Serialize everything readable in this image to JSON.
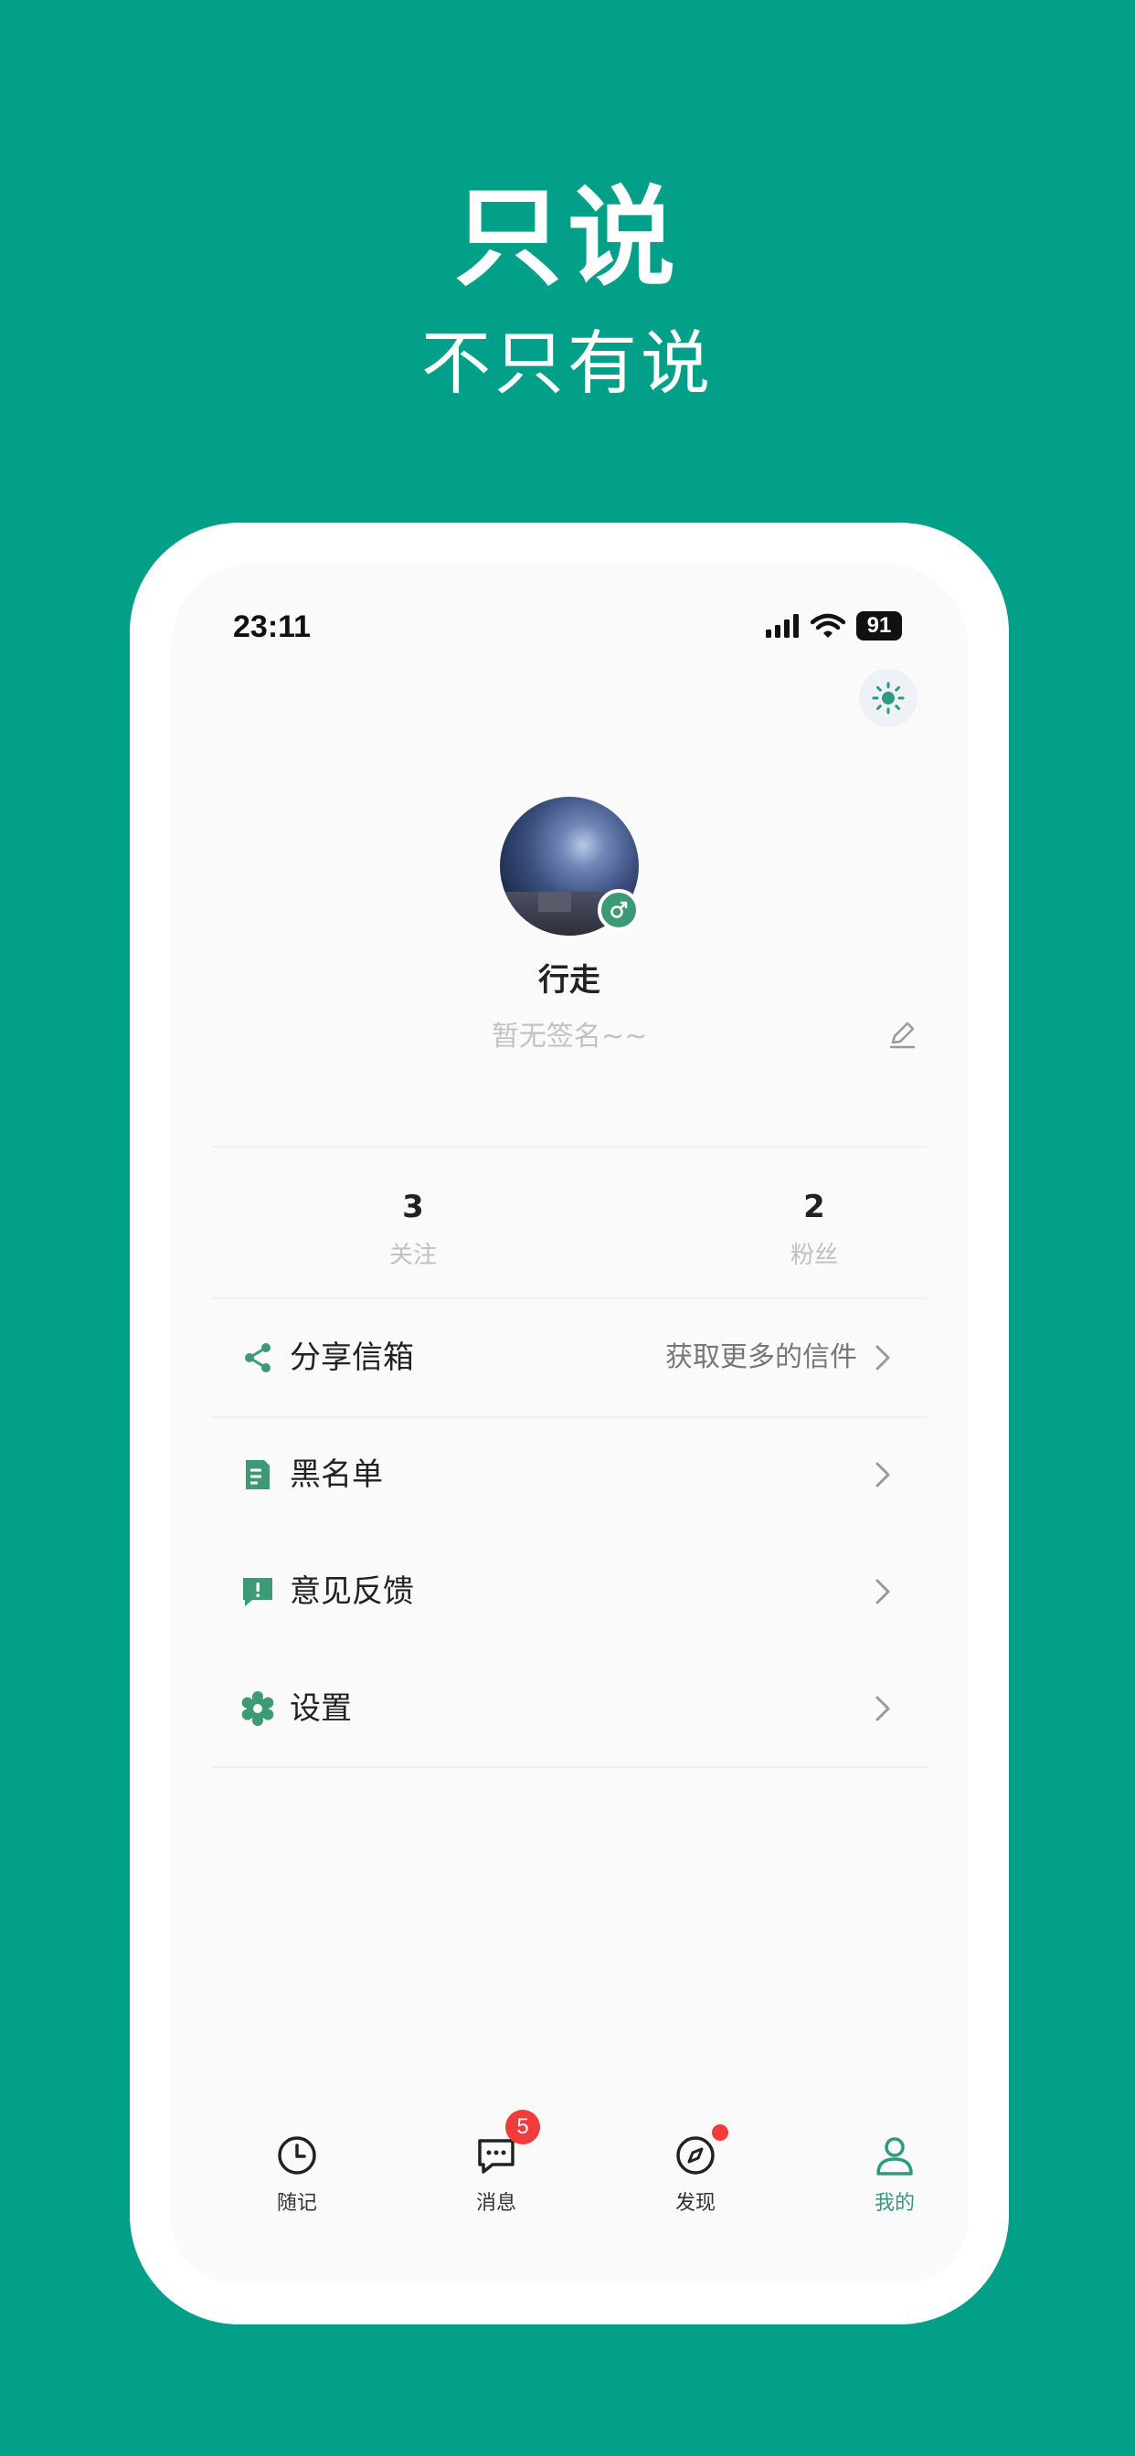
{
  "hero": {
    "title": "只说",
    "subtitle": "不只有说"
  },
  "status_bar": {
    "time": "23:11",
    "battery": "91"
  },
  "profile": {
    "username": "行走",
    "signature": "暂无签名~~"
  },
  "stats": [
    {
      "value": "3",
      "label": "关注"
    },
    {
      "value": "2",
      "label": "粉丝"
    }
  ],
  "menu": {
    "share": {
      "label": "分享信箱",
      "hint": "获取更多的信件"
    },
    "blacklist": {
      "label": "黑名单"
    },
    "feedback": {
      "label": "意见反馈"
    },
    "settings": {
      "label": "设置"
    }
  },
  "tabbar": {
    "notes": {
      "label": "随记"
    },
    "messages": {
      "label": "消息",
      "badge": "5"
    },
    "discover": {
      "label": "发现"
    },
    "mine": {
      "label": "我的"
    }
  },
  "colors": {
    "brand": "#02a088",
    "accent": "#2f9a82",
    "badge": "#f23b3b"
  }
}
